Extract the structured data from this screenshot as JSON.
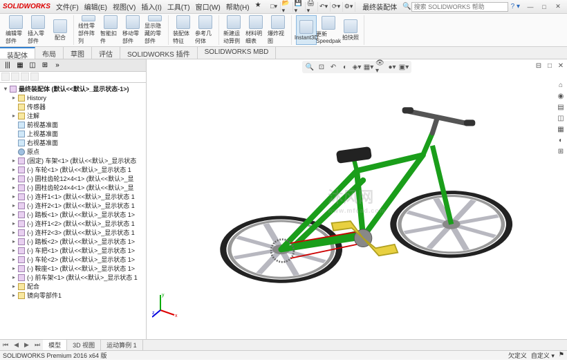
{
  "app": {
    "logo": "SOLIDWORKS",
    "doc_name": "最终装配体",
    "search_placeholder": "搜索 SOLIDWORKS 帮助"
  },
  "menu": [
    "文件(F)",
    "编辑(E)",
    "视图(V)",
    "插入(I)",
    "工具(T)",
    "窗口(W)",
    "帮助(H)"
  ],
  "ribbon": [
    {
      "label": "编辑零部件"
    },
    {
      "label": "插入零部件"
    },
    {
      "label": "配合"
    },
    {
      "label": "线性零部件阵列"
    },
    {
      "label": "智能扣件"
    },
    {
      "label": "移动零部件"
    },
    {
      "label": "显示隐藏的零部件"
    },
    {
      "label": "装配体特征"
    },
    {
      "label": "参考几何体"
    },
    {
      "label": "新建运动算例"
    },
    {
      "label": "材料明细表"
    },
    {
      "label": "爆炸视图"
    },
    {
      "label": "Instant3D"
    },
    {
      "label": "更新Speedpak"
    },
    {
      "label": "拍快照"
    }
  ],
  "tabs": [
    "装配体",
    "布局",
    "草图",
    "评估",
    "SOLIDWORKS 插件",
    "SOLIDWORKS MBD"
  ],
  "side_tabs": [
    "|||",
    "▦",
    "◫",
    "⊞"
  ],
  "tree": {
    "root": "最终装配体 (默认<<默认>_显示状态-1>)",
    "nodes": [
      {
        "icon": "fold",
        "label": "History",
        "indent": 1,
        "expand": "▸"
      },
      {
        "icon": "fold",
        "label": "传感器",
        "indent": 1,
        "expand": ""
      },
      {
        "icon": "fold",
        "label": "注解",
        "indent": 1,
        "expand": "▸"
      },
      {
        "icon": "plane",
        "label": "前视基准面",
        "indent": 1,
        "expand": ""
      },
      {
        "icon": "plane",
        "label": "上视基准面",
        "indent": 1,
        "expand": ""
      },
      {
        "icon": "plane",
        "label": "右视基准面",
        "indent": 1,
        "expand": ""
      },
      {
        "icon": "orig",
        "label": "原点",
        "indent": 1,
        "expand": ""
      },
      {
        "icon": "part",
        "label": "(固定) 车架<1> (默认<<默认>_显示状态",
        "indent": 1,
        "expand": "▸"
      },
      {
        "icon": "part",
        "label": "(-) 车轮<1> (默认<<默认>_显示状态 1",
        "indent": 1,
        "expand": "▸"
      },
      {
        "icon": "part",
        "label": "(-) 圆柱齿轮12×4<1> (默认<<默认>_显",
        "indent": 1,
        "expand": "▸"
      },
      {
        "icon": "part",
        "label": "(-) 圆柱齿轮24×4<1> (默认<<默认>_显",
        "indent": 1,
        "expand": "▸"
      },
      {
        "icon": "part",
        "label": "(-) 连杆1<1> (默认<<默认>_显示状态 1",
        "indent": 1,
        "expand": "▸"
      },
      {
        "icon": "part",
        "label": "(-) 连杆2<1> (默认<<默认>_显示状态 1",
        "indent": 1,
        "expand": "▸"
      },
      {
        "icon": "part",
        "label": "(-) 踏板<1> (默认<<默认>_显示状态 1>",
        "indent": 1,
        "expand": "▸"
      },
      {
        "icon": "part",
        "label": "(-) 连杆1<2> (默认<<默认>_显示状态 1",
        "indent": 1,
        "expand": "▸"
      },
      {
        "icon": "part",
        "label": "(-) 连杆2<3> (默认<<默认>_显示状态 1",
        "indent": 1,
        "expand": "▸"
      },
      {
        "icon": "part",
        "label": "(-) 踏板<2> (默认<<默认>_显示状态 1>",
        "indent": 1,
        "expand": "▸"
      },
      {
        "icon": "part",
        "label": "(-) 车把<1> (默认<<默认>_显示状态 1>",
        "indent": 1,
        "expand": "▸"
      },
      {
        "icon": "part",
        "label": "(-) 车轮<2> (默认<<默认>_显示状态 1>",
        "indent": 1,
        "expand": "▸"
      },
      {
        "icon": "part",
        "label": "(-) 鞍座<1> (默认<<默认>_显示状态 1>",
        "indent": 1,
        "expand": "▸"
      },
      {
        "icon": "part",
        "label": "(-) 前车架<1> (默认<<默认>_显示状态 1",
        "indent": 1,
        "expand": "▸"
      },
      {
        "icon": "fold",
        "label": "配合",
        "indent": 1,
        "expand": "▸"
      },
      {
        "icon": "fold",
        "label": "镜向零部件1",
        "indent": 1,
        "expand": "▸"
      }
    ]
  },
  "bottom_tabs": [
    "模型",
    "3D 视图",
    "运动算例 1"
  ],
  "status": {
    "left": "SOLIDWORKS Premium 2016 x64 版",
    "right": [
      "欠定义",
      "自定义 ▾"
    ]
  },
  "watermark": {
    "main": "沐风网",
    "sub": "www.mfcad.com"
  }
}
